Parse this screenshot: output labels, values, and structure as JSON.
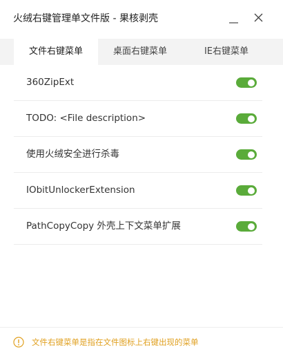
{
  "window": {
    "title": "火绒右键管理单文件版 - 果核剥壳",
    "minimize_icon": "minimize-icon",
    "close_icon": "close-icon"
  },
  "tabs": [
    {
      "label": "文件右键菜单",
      "active": true
    },
    {
      "label": "桌面右键菜单",
      "active": false
    },
    {
      "label": "IE右键菜单",
      "active": false
    }
  ],
  "items": [
    {
      "label": "360ZipExt",
      "enabled": true
    },
    {
      "label": "TODO: <File description>",
      "enabled": true
    },
    {
      "label": "使用火绒安全进行杀毒",
      "enabled": true
    },
    {
      "label": "IObitUnlockerExtension",
      "enabled": true
    },
    {
      "label": "PathCopyCopy 外壳上下文菜单扩展",
      "enabled": true
    }
  ],
  "footer": {
    "icon": "info-icon",
    "text": "文件右键菜单是指在文件图标上右键出现的菜单"
  },
  "colors": {
    "toggle_on": "#5aab3a",
    "footer_text": "#e0a020",
    "tab_bar_bg": "#f3f3f3"
  }
}
